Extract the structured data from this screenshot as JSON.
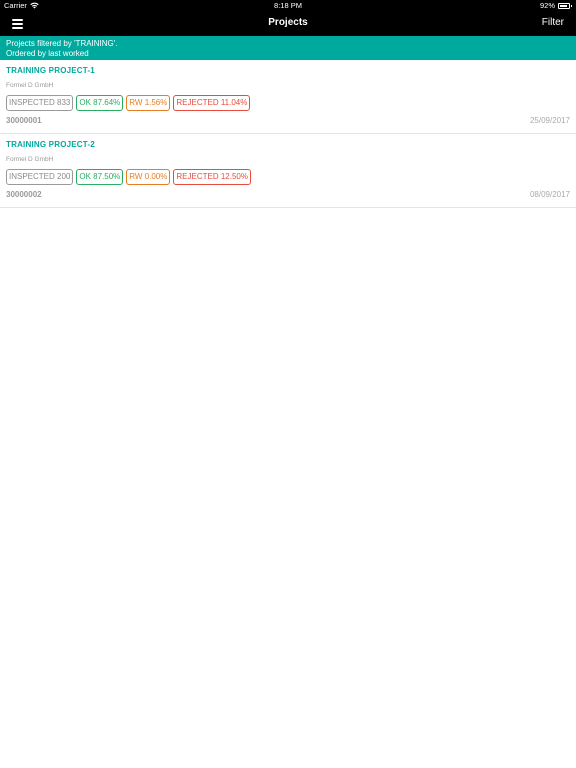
{
  "status_bar": {
    "carrier": "Carrier",
    "time": "8:18 PM",
    "battery_percent": "92%",
    "battery_level": 0.92,
    "wifi_icon": "wifi-icon",
    "battery_icon": "battery-icon"
  },
  "nav": {
    "menu_icon": "hamburger-menu-icon",
    "title": "Projects",
    "filter_label": "Filter"
  },
  "banner": {
    "line1": "Projects filtered by 'TRAINING'.",
    "line2": "Ordered by last worked"
  },
  "colors": {
    "accent": "#00a99d",
    "ok": "#27ae60",
    "rw": "#e67e22",
    "rejected": "#e74c3c",
    "inspected": "#8a8a8a"
  },
  "projects": [
    {
      "title": "TRAINING PROJECT-1",
      "company": "Formel D GmbH",
      "inspected": "INSPECTED 833",
      "ok": "OK 87.64%",
      "rw": "RW 1.56%",
      "rejected": "REJECTED 11.04%",
      "number": "30000001",
      "date": "25/09/2017"
    },
    {
      "title": "TRAINING PROJECT-2",
      "company": "Formel D GmbH",
      "inspected": "INSPECTED 200",
      "ok": "OK 87.50%",
      "rw": "RW 0.00%",
      "rejected": "REJECTED 12.50%",
      "number": "30000002",
      "date": "08/09/2017"
    }
  ]
}
